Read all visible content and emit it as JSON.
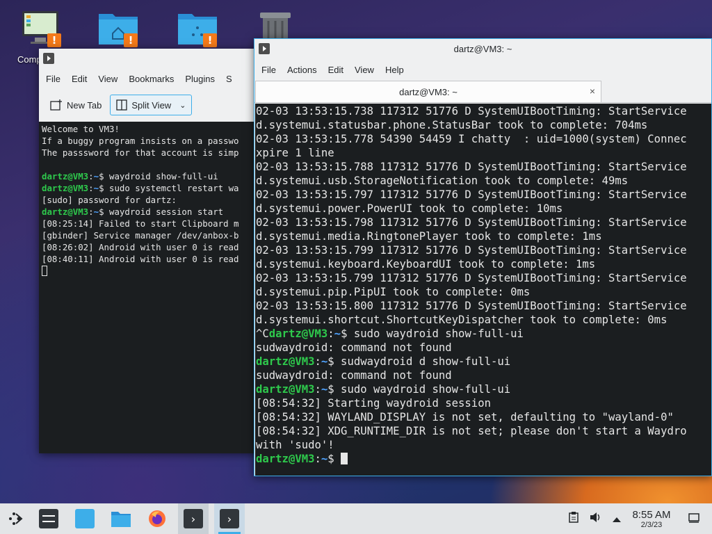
{
  "desktop": {
    "computer_label": "Comp",
    "warning_badge": "!"
  },
  "left_window": {
    "menu": [
      "File",
      "Edit",
      "View",
      "Bookmarks",
      "Plugins",
      "S"
    ],
    "new_tab_label": "New Tab",
    "split_view_label": "Split View",
    "lines": [
      [
        {
          "t": "Welcome to VM3!",
          "c": ""
        }
      ],
      [
        {
          "t": "If a buggy program insists on a passwo",
          "c": ""
        }
      ],
      [
        {
          "t": "The passsword for that account is simp",
          "c": ""
        }
      ],
      [
        {
          "t": "",
          "c": ""
        }
      ],
      [
        {
          "t": "dartz@VM3",
          "c": "g"
        },
        {
          "t": ":",
          "c": ""
        },
        {
          "t": "~",
          "c": "b"
        },
        {
          "t": "$ waydroid show-full-ui",
          "c": ""
        }
      ],
      [
        {
          "t": "dartz@VM3",
          "c": "g"
        },
        {
          "t": ":",
          "c": ""
        },
        {
          "t": "~",
          "c": "b"
        },
        {
          "t": "$ sudo systemctl restart wa",
          "c": ""
        }
      ],
      [
        {
          "t": "[sudo] password for dartz:",
          "c": ""
        }
      ],
      [
        {
          "t": "dartz@VM3",
          "c": "g"
        },
        {
          "t": ":",
          "c": ""
        },
        {
          "t": "~",
          "c": "b"
        },
        {
          "t": "$ waydroid session start",
          "c": ""
        }
      ],
      [
        {
          "t": "[08:25:14] Failed to start Clipboard m",
          "c": ""
        }
      ],
      [
        {
          "t": "[gbinder] Service manager /dev/anbox-b",
          "c": ""
        }
      ],
      [
        {
          "t": "[08:26:02] Android with user 0 is read",
          "c": ""
        }
      ],
      [
        {
          "t": "[08:40:11] Android with user 0 is read",
          "c": ""
        }
      ]
    ]
  },
  "right_window": {
    "title": "dartz@VM3: ~",
    "tab_title": "dartz@VM3: ~",
    "tab_close": "×",
    "menu": [
      "File",
      "Actions",
      "Edit",
      "View",
      "Help"
    ],
    "lines": [
      [
        {
          "t": "02-03 13:53:15.738 117312 51776 D SystemUIBootTiming: StartService",
          "c": ""
        }
      ],
      [
        {
          "t": "d.systemui.statusbar.phone.StatusBar took to complete: 704ms",
          "c": ""
        }
      ],
      [
        {
          "t": "02-03 13:53:15.778 54390 54459 I chatty  : uid=1000(system) Connec",
          "c": ""
        }
      ],
      [
        {
          "t": "xpire 1 line",
          "c": ""
        }
      ],
      [
        {
          "t": "02-03 13:53:15.788 117312 51776 D SystemUIBootTiming: StartService",
          "c": ""
        }
      ],
      [
        {
          "t": "d.systemui.usb.StorageNotification took to complete: 49ms",
          "c": ""
        }
      ],
      [
        {
          "t": "02-03 13:53:15.797 117312 51776 D SystemUIBootTiming: StartService",
          "c": ""
        }
      ],
      [
        {
          "t": "d.systemui.power.PowerUI took to complete: 10ms",
          "c": ""
        }
      ],
      [
        {
          "t": "02-03 13:53:15.798 117312 51776 D SystemUIBootTiming: StartService",
          "c": ""
        }
      ],
      [
        {
          "t": "d.systemui.media.RingtonePlayer took to complete: 1ms",
          "c": ""
        }
      ],
      [
        {
          "t": "02-03 13:53:15.799 117312 51776 D SystemUIBootTiming: StartService",
          "c": ""
        }
      ],
      [
        {
          "t": "d.systemui.keyboard.KeyboardUI took to complete: 1ms",
          "c": ""
        }
      ],
      [
        {
          "t": "02-03 13:53:15.799 117312 51776 D SystemUIBootTiming: StartService",
          "c": ""
        }
      ],
      [
        {
          "t": "d.systemui.pip.PipUI took to complete: 0ms",
          "c": ""
        }
      ],
      [
        {
          "t": "02-03 13:53:15.800 117312 51776 D SystemUIBootTiming: StartService",
          "c": ""
        }
      ],
      [
        {
          "t": "d.systemui.shortcut.ShortcutKeyDispatcher took to complete: 0ms",
          "c": ""
        }
      ],
      [
        {
          "t": "^C",
          "c": ""
        },
        {
          "t": "dartz@VM3",
          "c": "g"
        },
        {
          "t": ":",
          "c": ""
        },
        {
          "t": "~",
          "c": "b"
        },
        {
          "t": "$ sudo waydroid show-full-ui",
          "c": ""
        }
      ],
      [
        {
          "t": "sudwaydroid: command not found",
          "c": ""
        }
      ],
      [
        {
          "t": "dartz@VM3",
          "c": "g"
        },
        {
          "t": ":",
          "c": ""
        },
        {
          "t": "~",
          "c": "b"
        },
        {
          "t": "$ sudwaydroid d show-full-ui",
          "c": ""
        }
      ],
      [
        {
          "t": "sudwaydroid: command not found",
          "c": ""
        }
      ],
      [
        {
          "t": "dartz@VM3",
          "c": "g"
        },
        {
          "t": ":",
          "c": ""
        },
        {
          "t": "~",
          "c": "b"
        },
        {
          "t": "$ sudo waydroid show-full-ui",
          "c": ""
        }
      ],
      [
        {
          "t": "[08:54:32] Starting waydroid session",
          "c": ""
        }
      ],
      [
        {
          "t": "[08:54:32] WAYLAND_DISPLAY is not set, defaulting to \"wayland-0\"",
          "c": ""
        }
      ],
      [
        {
          "t": "[08:54:32] XDG_RUNTIME_DIR is not set; please don't start a Waydro",
          "c": ""
        }
      ],
      [
        {
          "t": "with 'sudo'!",
          "c": ""
        }
      ],
      [
        {
          "t": "dartz@VM3",
          "c": "g"
        },
        {
          "t": ":",
          "c": ""
        },
        {
          "t": "~",
          "c": "b"
        },
        {
          "t": "$ ",
          "c": ""
        }
      ]
    ]
  },
  "taskbar": {
    "time": "8:55 AM",
    "date": "2/3/23"
  },
  "colors": {
    "prompt_user": "#2ec94c",
    "prompt_path": "#4fa3ff",
    "accent": "#3daee9",
    "warning": "#f47a1a"
  }
}
